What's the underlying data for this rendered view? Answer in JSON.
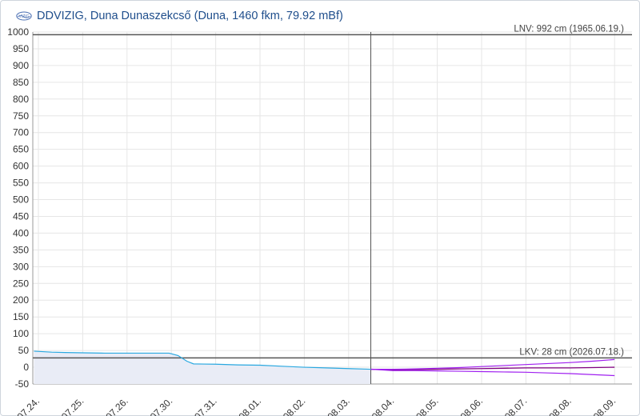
{
  "header": {
    "logo_text": "VIZIG",
    "title": "DDVIZIG, Duna Dunaszekcső (Duna, 1460 fkm, 79.92 mBf)"
  },
  "colors": {
    "observed": "#29a8e0",
    "forecast": "#800080",
    "forecast_band": "#a020f0",
    "area_fill": "#e9ecf6",
    "ref_line": "#555555",
    "grid": "#e6e6e6"
  },
  "chart_data": {
    "type": "line",
    "title": "DDVIZIG, Duna Dunaszekcső (Duna, 1460 fkm, 79.92 mBf)",
    "xlabel": "",
    "ylabel": "",
    "ylim": [
      -50,
      1000
    ],
    "yticks": [
      1000,
      950,
      900,
      850,
      800,
      750,
      700,
      650,
      600,
      550,
      500,
      450,
      400,
      350,
      300,
      250,
      200,
      150,
      100,
      50,
      0,
      -50
    ],
    "xticks": [
      "07.24.",
      "07.25.",
      "07.26.",
      "07.30.",
      "07.31.",
      "08.01.",
      "08.02.",
      "08.03.",
      "08.04.",
      "08.05.",
      "08.06.",
      "08.07.",
      "08.08.",
      "08.09."
    ],
    "grid": true,
    "reference_lines": [
      {
        "name": "LNV",
        "value": 992,
        "label": "LNV: 992 cm (1965.06.19.)"
      },
      {
        "name": "LKV",
        "value": 28,
        "label": "LKV: 28 cm (2026.07.18.)"
      }
    ],
    "now_marker": 7.5,
    "series": [
      {
        "role": "observed",
        "x": [
          -0.1,
          0.3,
          0.6,
          1.0,
          1.5,
          2.0,
          2.5,
          2.95,
          3.15,
          3.35,
          3.5,
          4.0,
          4.5,
          5.0,
          5.5,
          6.0,
          6.5,
          7.0,
          7.5
        ],
        "values": [
          48,
          45,
          44,
          43,
          42,
          42,
          42,
          42,
          35,
          18,
          10,
          9,
          7,
          6,
          3,
          0,
          -2,
          -4,
          -6
        ]
      },
      {
        "role": "forecast",
        "x": [
          7.5,
          8.0,
          8.5,
          9.0,
          9.5,
          10.0,
          10.5,
          11.0,
          11.5,
          12.0,
          12.5,
          13.0
        ],
        "values": [
          -6,
          -8,
          -7,
          -6,
          -5,
          -4,
          -3,
          -2,
          -2,
          -2,
          -1,
          0
        ]
      },
      {
        "role": "forecast_upper",
        "x": [
          7.5,
          8.0,
          8.5,
          9.0,
          9.5,
          10.0,
          10.5,
          11.0,
          11.5,
          12.0,
          12.5,
          13.0
        ],
        "values": [
          -6,
          -6,
          -5,
          -3,
          -1,
          2,
          5,
          8,
          11,
          14,
          18,
          23
        ]
      },
      {
        "role": "forecast_lower",
        "x": [
          7.5,
          8.0,
          8.5,
          9.0,
          9.5,
          10.0,
          10.5,
          11.0,
          11.5,
          12.0,
          12.5,
          13.0
        ],
        "values": [
          -6,
          -10,
          -10,
          -11,
          -12,
          -13,
          -14,
          -15,
          -17,
          -19,
          -22,
          -25
        ]
      }
    ]
  }
}
